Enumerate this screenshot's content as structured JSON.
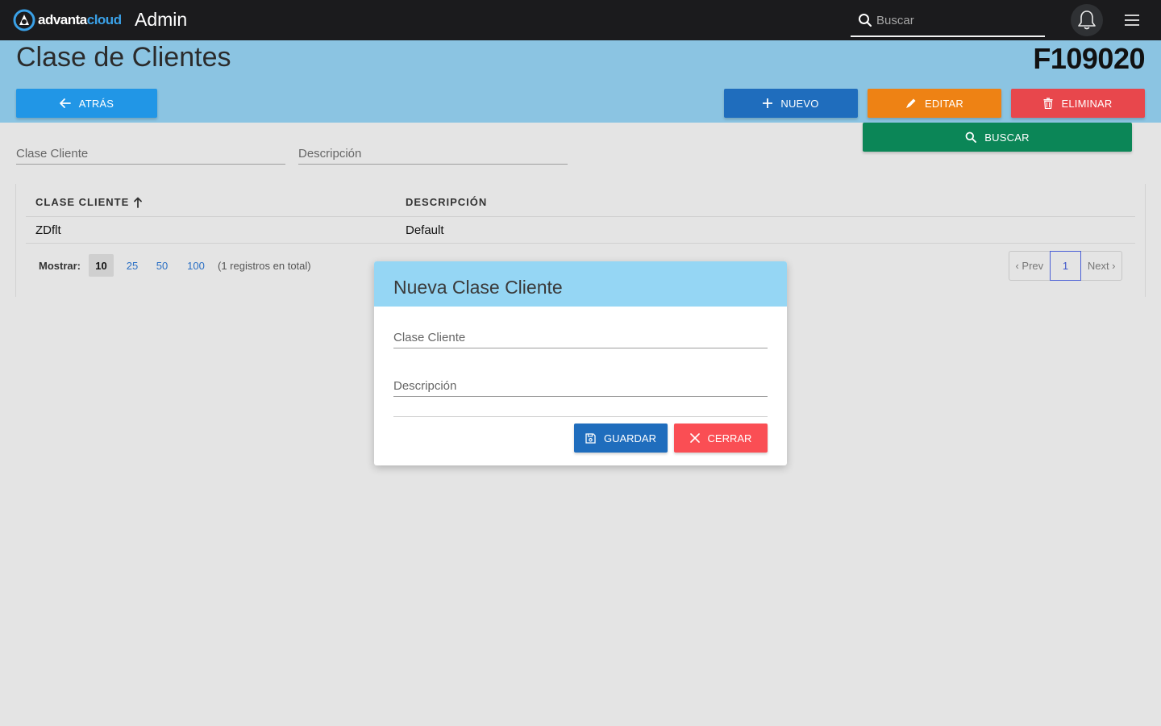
{
  "topbar": {
    "logo_part_a": "advanta",
    "logo_part_b": "cloud",
    "app_title": "Admin",
    "search_placeholder": "Buscar",
    "icons": [
      "search-icon",
      "bell-icon",
      "hamburger-menu-icon"
    ]
  },
  "header": {
    "title": "Clase de Clientes",
    "code": "F109020"
  },
  "actions": {
    "back": "ATRÁS",
    "new": "NUEVO",
    "edit": "EDITAR",
    "delete": "ELIMINAR",
    "search": "BUSCAR"
  },
  "filters": {
    "clase_cliente_placeholder": "Clase Cliente",
    "descripcion_placeholder": "Descripción"
  },
  "table": {
    "columns": [
      "CLASE CLIENTE",
      "DESCRIPCIÓN"
    ],
    "sort_column": "CLASE CLIENTE",
    "rows": [
      {
        "clase_cliente": "ZDflt",
        "descripcion": "Default"
      }
    ]
  },
  "pagination": {
    "show_label": "Mostrar:",
    "page_sizes": [
      "10",
      "25",
      "50",
      "100"
    ],
    "active_page_size": "10",
    "total_text": "(1 registros en total)",
    "prev": "‹ Prev",
    "current_page": "1",
    "next": "Next ›"
  },
  "modal": {
    "title": "Nueva Clase Cliente",
    "field_clase_placeholder": "Clase Cliente",
    "field_descripcion_placeholder": "Descripción",
    "save": "GUARDAR",
    "close": "CERRAR"
  },
  "colors": {
    "topbar": "#1b1b1d",
    "header_band": "#8bc4e2",
    "back": "#2196e6",
    "new": "#1f6dbd",
    "edit": "#ee8214",
    "delete": "#e8474c",
    "search": "#0b8657",
    "modal_header": "#95d6f4",
    "close": "#fa4e54"
  }
}
